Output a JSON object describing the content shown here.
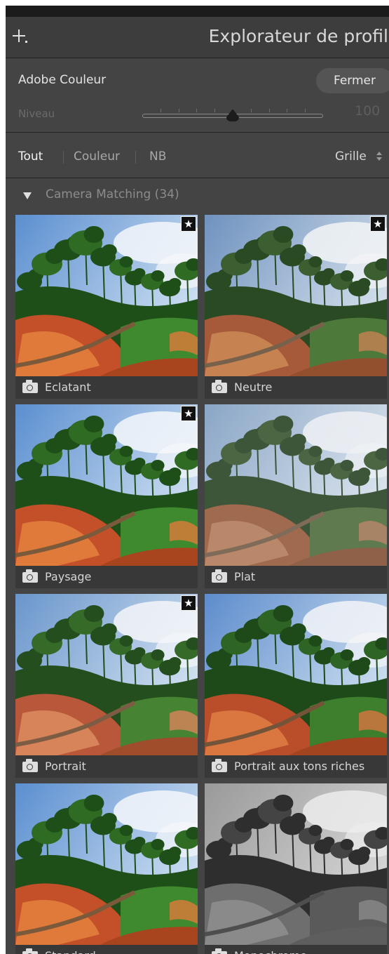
{
  "header": {
    "title": "Explorateur de profils"
  },
  "profile": {
    "name": "Adobe Couleur",
    "close_label": "Fermer"
  },
  "level": {
    "label": "Niveau",
    "value": "100",
    "fraction": 0.5
  },
  "filters": {
    "items": [
      {
        "label": "Tout",
        "active": true
      },
      {
        "label": "Couleur",
        "active": false
      },
      {
        "label": "NB",
        "active": false
      }
    ],
    "view": "Grille"
  },
  "group": {
    "label": "Camera Matching (34)"
  },
  "tiles": [
    {
      "name": "Eclatant",
      "favorite": true,
      "mode": "vivid"
    },
    {
      "name": "Neutre",
      "favorite": true,
      "mode": "neutral"
    },
    {
      "name": "Paysage",
      "favorite": true,
      "mode": "vivid"
    },
    {
      "name": "Plat",
      "favorite": false,
      "mode": "flat"
    },
    {
      "name": "Portrait",
      "favorite": true,
      "mode": "portrait"
    },
    {
      "name": "Portrait aux tons riches",
      "favorite": false,
      "mode": "rich"
    },
    {
      "name": "Standard",
      "favorite": false,
      "mode": "vivid"
    },
    {
      "name": "Monochrome",
      "favorite": false,
      "mode": "mono"
    }
  ],
  "colors": {
    "panel_bg": "#444444",
    "header_bg": "#3d3d3d",
    "button_bg": "#545454",
    "text_active": "#f2f2f2",
    "text_inactive": "#a8a8a8"
  }
}
